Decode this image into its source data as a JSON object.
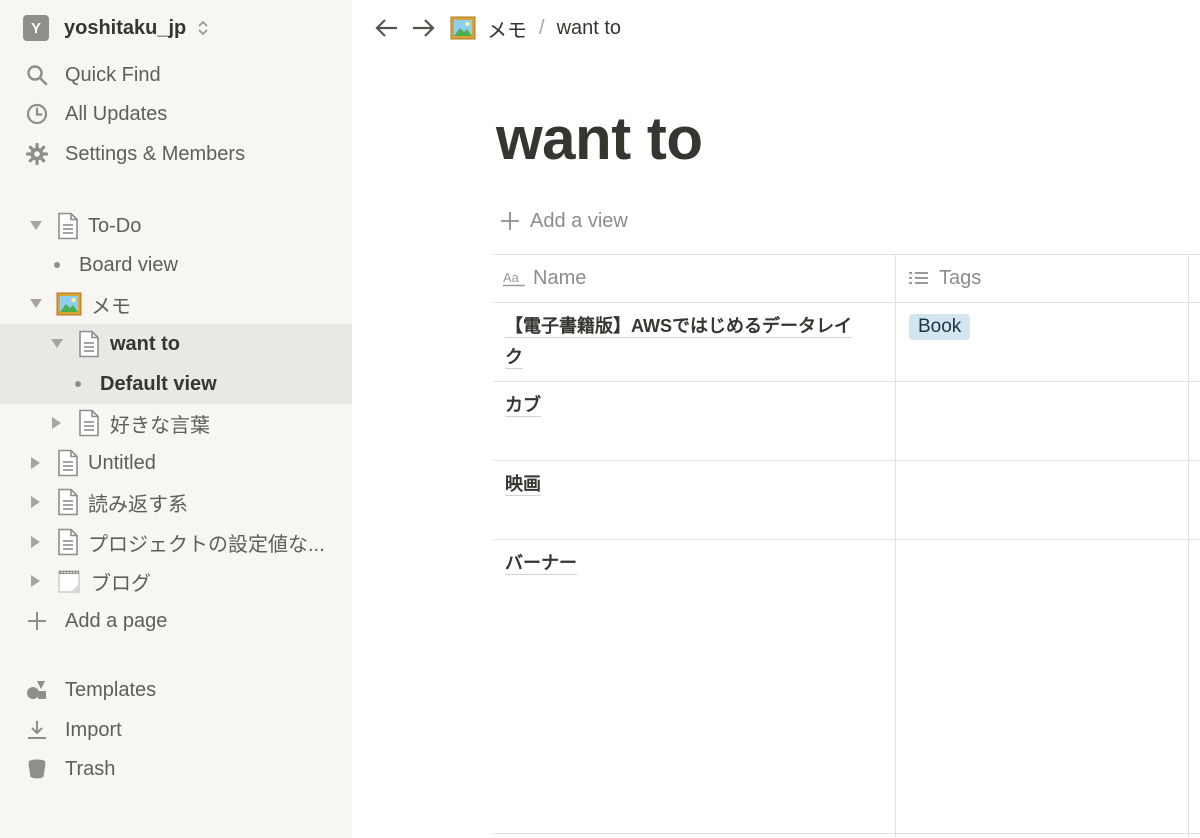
{
  "workspace": {
    "avatar_letter": "Y",
    "name": "yoshitaku_jp"
  },
  "sidebar": {
    "top_items": [
      {
        "label": "Quick Find",
        "icon": "search-icon"
      },
      {
        "label": "All Updates",
        "icon": "clock-icon"
      },
      {
        "label": "Settings & Members",
        "icon": "gear-icon"
      }
    ],
    "tree": [
      {
        "label": "To-Do",
        "icon": "page-icon",
        "expanded": true
      },
      {
        "label": "Board view",
        "icon": "bullet"
      },
      {
        "label": "メモ",
        "icon": "framed-picture-emoji",
        "expanded": true
      },
      {
        "label": "want to",
        "icon": "page-icon",
        "expanded": true,
        "selected": true
      },
      {
        "label": "Default view",
        "icon": "bullet",
        "selected": true
      },
      {
        "label": "好きな言葉",
        "icon": "page-icon",
        "expanded": false
      },
      {
        "label": "Untitled",
        "icon": "page-icon",
        "expanded": false
      },
      {
        "label": "読み返す系",
        "icon": "page-icon",
        "expanded": false
      },
      {
        "label": "プロジェクトの設定値な...",
        "icon": "page-icon",
        "expanded": false
      },
      {
        "label": "ブログ",
        "icon": "notepad-emoji",
        "expanded": false
      }
    ],
    "add_page": "Add a page",
    "bottom_items": [
      {
        "label": "Templates",
        "icon": "templates-icon"
      },
      {
        "label": "Import",
        "icon": "import-icon"
      },
      {
        "label": "Trash",
        "icon": "trash-icon"
      }
    ]
  },
  "topbar": {
    "breadcrumbs": [
      "メモ",
      "want to"
    ],
    "separator": "/"
  },
  "page": {
    "title": "want to",
    "add_view": "Add a view"
  },
  "table": {
    "columns": [
      {
        "label": "Name",
        "icon": "text-property-icon"
      },
      {
        "label": "Tags",
        "icon": "list-property-icon"
      }
    ],
    "rows": [
      {
        "name_line1": "【電子書籍版】AWSではじめるデータレイ",
        "name_line2": "ク",
        "tags": [
          "Book"
        ]
      },
      {
        "name_line1": "カブ",
        "name_line2": "",
        "tags": []
      },
      {
        "name_line1": "映画",
        "name_line2": "",
        "tags": []
      },
      {
        "name_line1": "バーナー",
        "name_line2": "",
        "tags": []
      }
    ],
    "tag_color": "#d3e5ef"
  },
  "colors": {
    "sidebar_bg": "#f7f6f3",
    "selected_bg": "#e9e8e4",
    "text": "#37352f",
    "muted": "#8d8c89"
  }
}
